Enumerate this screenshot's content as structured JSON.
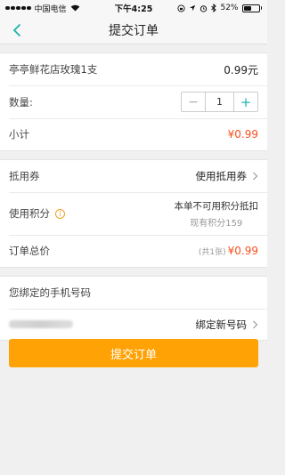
{
  "status_bar": {
    "carrier": "中国电信",
    "time": "下午4:25",
    "battery_label": "52%",
    "battery_level": 0.52
  },
  "nav": {
    "title": "提交订单"
  },
  "product": {
    "name": "亭亭鲜花店玫瑰1支",
    "price": "0.99元"
  },
  "quantity": {
    "label": "数量:",
    "minus": "−",
    "value": "1",
    "plus": "+"
  },
  "subtotal": {
    "label": "小计",
    "value": "¥0.99"
  },
  "coupon": {
    "label": "抵用券",
    "action": "使用抵用券"
  },
  "points": {
    "label": "使用积分",
    "info": "i",
    "note": "本单不可用积分抵扣",
    "current": "现有积分159"
  },
  "total": {
    "label": "订单总价",
    "count": "(共1张)",
    "value": "¥0.99"
  },
  "phone": {
    "header": "您绑定的手机号码",
    "bind_new": "绑定新号码"
  },
  "submit_label": "提交订单",
  "colors": {
    "accent_orange": "#ffa206",
    "price_red": "#f4511e",
    "teal": "#20b2aa"
  }
}
